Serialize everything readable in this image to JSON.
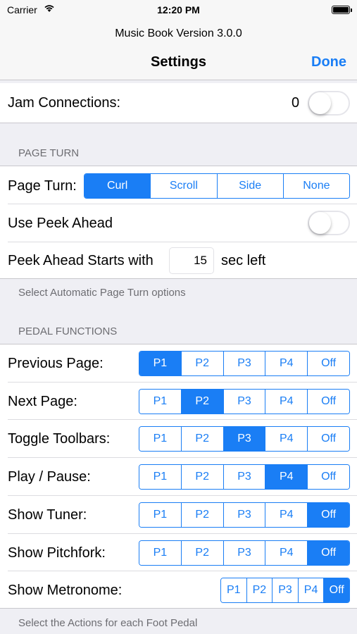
{
  "status_bar": {
    "carrier": "Carrier",
    "time": "12:20 PM"
  },
  "nav": {
    "subtitle": "Music Book Version 3.0.0",
    "title": "Settings",
    "done_label": "Done"
  },
  "jam": {
    "label": "Jam Connections:",
    "count": "0",
    "switch_on": false
  },
  "page_turn_section": {
    "header": "PAGE TURN",
    "page_turn_label": "Page Turn:",
    "page_turn_options": [
      "Curl",
      "Scroll",
      "Side",
      "None"
    ],
    "page_turn_selected": "Curl",
    "peek_label": "Use Peek Ahead",
    "peek_on": false,
    "peek_starts_label": "Peek Ahead Starts with",
    "peek_seconds": "15",
    "peek_suffix": "sec left",
    "footer": "Select Automatic Page Turn options"
  },
  "pedal_section": {
    "header": "PEDAL FUNCTIONS",
    "options": [
      "P1",
      "P2",
      "P3",
      "P4",
      "Off"
    ],
    "rows": [
      {
        "label": "Previous Page:",
        "selected": "P1"
      },
      {
        "label": "Next Page:",
        "selected": "P2"
      },
      {
        "label": "Toggle Toolbars:",
        "selected": "P3"
      },
      {
        "label": "Play / Pause:",
        "selected": "P4"
      },
      {
        "label": "Show Tuner:",
        "selected": "Off"
      },
      {
        "label": "Show Pitchfork:",
        "selected": "Off"
      },
      {
        "label": "Show Metronome:",
        "selected": "Off"
      }
    ],
    "footer": "Select the Actions for each Foot Pedal"
  },
  "colors": {
    "accent": "#1a7ef5",
    "background": "#efeff4",
    "header_text": "#6d6d72"
  }
}
